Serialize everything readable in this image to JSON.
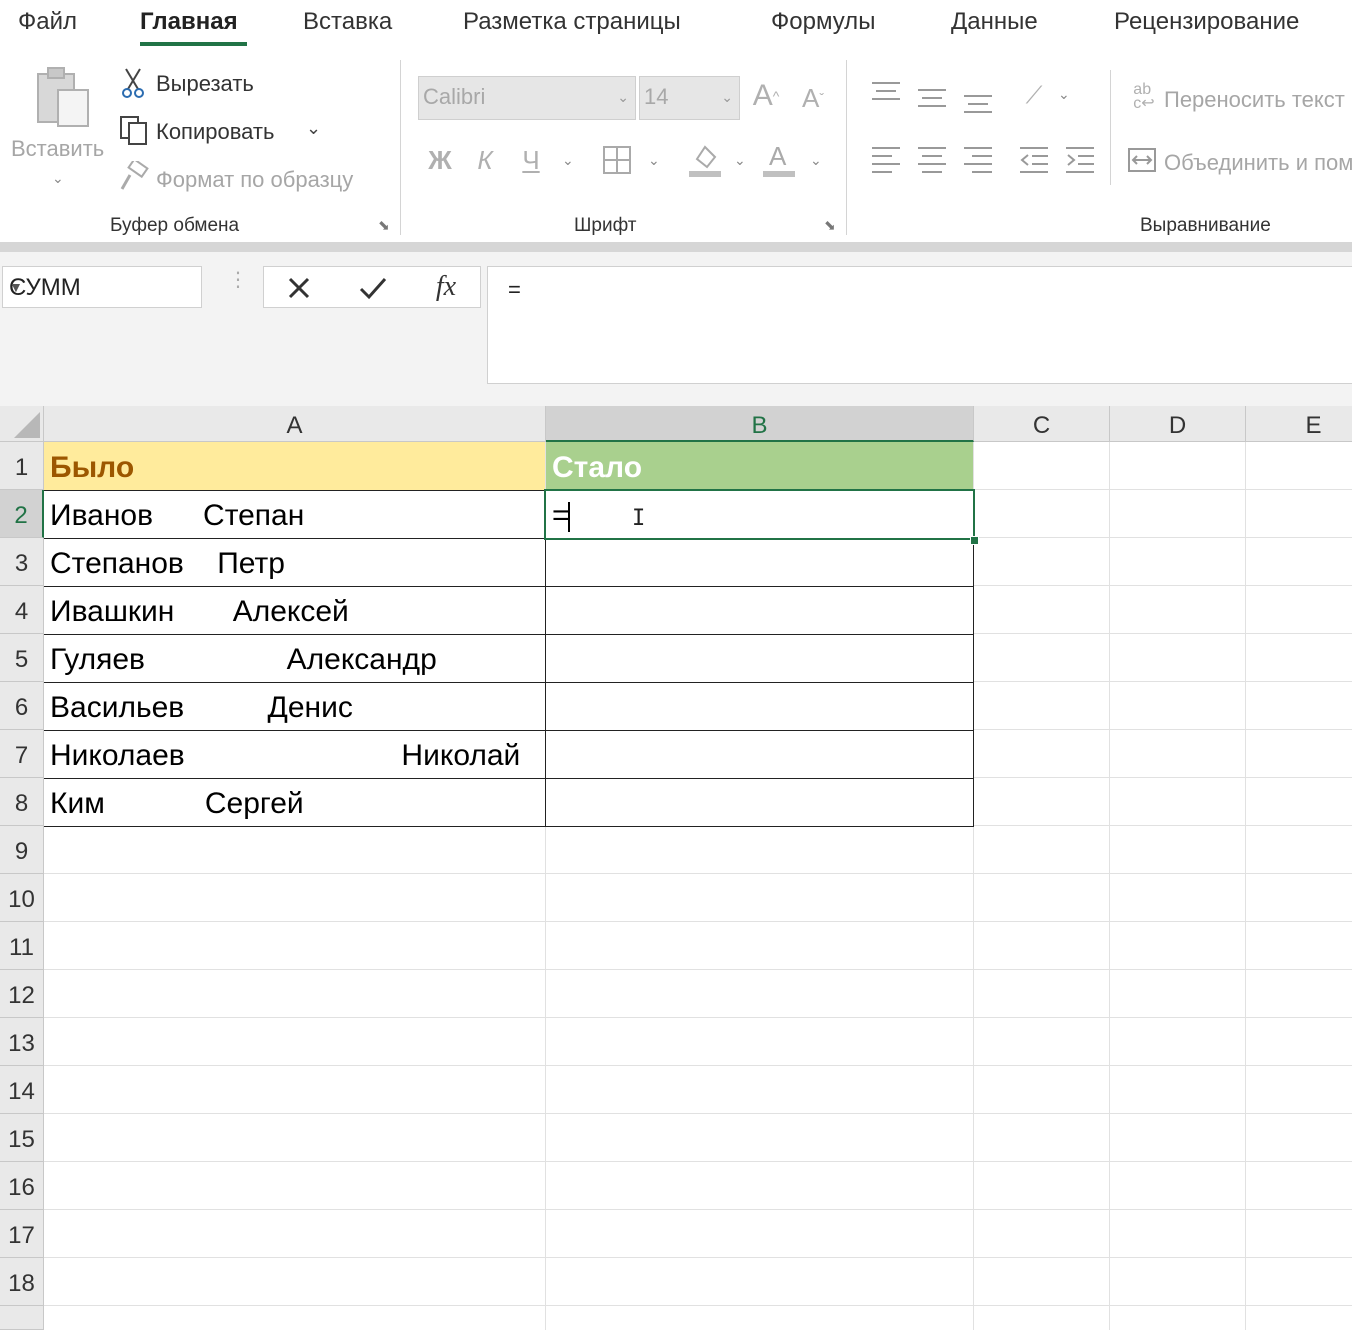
{
  "tabs": [
    {
      "label": "Файл",
      "active": false
    },
    {
      "label": "Главная",
      "active": true
    },
    {
      "label": "Вставка",
      "active": false
    },
    {
      "label": "Разметка страницы",
      "active": false
    },
    {
      "label": "Формулы",
      "active": false
    },
    {
      "label": "Данные",
      "active": false
    },
    {
      "label": "Рецензирование",
      "active": false
    }
  ],
  "clipboard": {
    "paste": "Вставить",
    "cut": "Вырезать",
    "copy": "Копировать",
    "format_painter": "Формат по образцу",
    "group_label": "Буфер обмена"
  },
  "font": {
    "name": "Calibri",
    "size": "14",
    "bold": "Ж",
    "italic": "К",
    "underline": "Ч",
    "group_label": "Шрифт"
  },
  "alignment": {
    "wrap_text": "Переносить текст",
    "merge": "Объединить и поместить в центре",
    "group_label": "Выравнивание"
  },
  "formula_bar": {
    "name_box": "СУММ",
    "fx": "fx",
    "formula": "="
  },
  "sheet": {
    "columns": [
      "A",
      "B",
      "C",
      "D",
      "E"
    ],
    "rows": [
      "1",
      "2",
      "3",
      "4",
      "5",
      "6",
      "7",
      "8",
      "9",
      "10",
      "11",
      "12",
      "13",
      "14",
      "15",
      "16",
      "17",
      "18"
    ],
    "header_a": "Было",
    "header_b": "Стало",
    "names": [
      "Иванов      Степан",
      "Степанов    Петр",
      "Ивашкин       Алексей",
      "Гуляев                 Александр",
      "Васильев          Денис",
      "Николаев                          Николай",
      "Ким            Сергей"
    ],
    "active_cell_text": "="
  },
  "colors": {
    "accent": "#217346",
    "header_a_fill": "#ffeb9c",
    "header_a_text": "#9c5700",
    "header_b_fill": "#a9d08e"
  }
}
